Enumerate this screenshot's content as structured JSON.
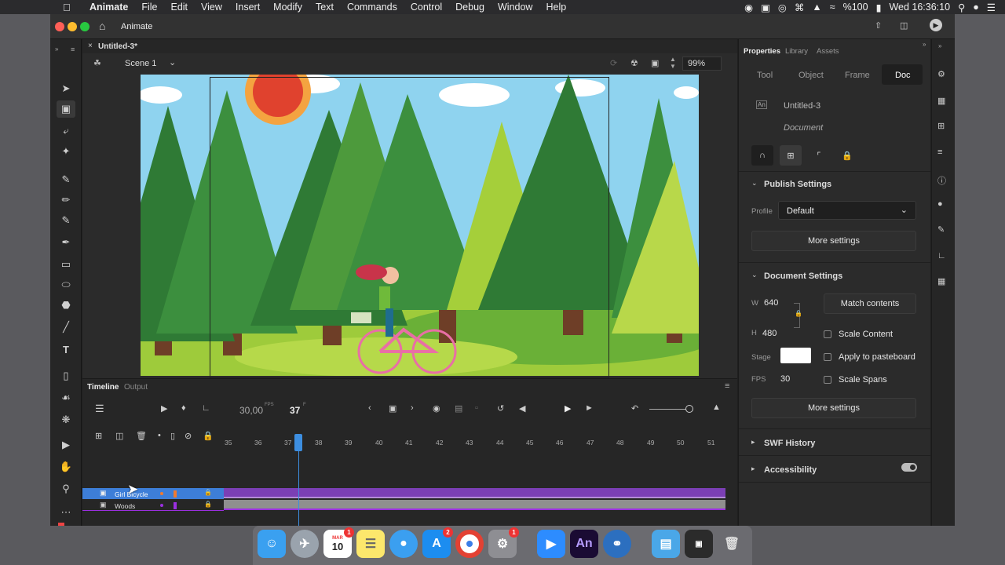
{
  "menubar": {
    "items": [
      "Animate",
      "File",
      "Edit",
      "View",
      "Insert",
      "Modify",
      "Text",
      "Commands",
      "Control",
      "Debug",
      "Window",
      "Help"
    ],
    "battery": "%100",
    "clock": "Wed 16:36:10"
  },
  "window": {
    "home_label": "Animate"
  },
  "document": {
    "tab_title": "Untitled-3*",
    "scene": "Scene 1",
    "zoom": "99%"
  },
  "timeline": {
    "tab_timeline": "Timeline",
    "tab_output": "Output",
    "fps": "30,00",
    "fps_unit": "FPS",
    "frame": "37",
    "frame_unit": "F",
    "ruler": [
      "35",
      "36",
      "37",
      "38",
      "39",
      "40",
      "41",
      "42",
      "43",
      "44",
      "45",
      "46",
      "47",
      "48",
      "49",
      "50",
      "51"
    ],
    "layers": [
      {
        "name": "Girl Bicycle",
        "color": "#f07a30"
      },
      {
        "name": "Woods",
        "color": "#9b2fe0"
      }
    ]
  },
  "properties": {
    "panel_tabs": [
      "Properties",
      "Library",
      "Assets"
    ],
    "sub_tabs": [
      "Tool",
      "Object",
      "Frame",
      "Doc"
    ],
    "doc_name": "Untitled-3",
    "doc_type": "Document",
    "publish_settings": "Publish Settings",
    "profile_label": "Profile",
    "profile_value": "Default",
    "more_settings": "More settings",
    "document_settings": "Document Settings",
    "w_label": "W",
    "w_value": "640",
    "h_label": "H",
    "h_value": "480",
    "match_contents": "Match contents",
    "scale_content": "Scale Content",
    "stage_label": "Stage",
    "apply_pasteboard": "Apply to pasteboard",
    "fps_label": "FPS",
    "fps_value": "30",
    "scale_spans": "Scale Spans",
    "more_settings2": "More settings",
    "swf_history": "SWF History",
    "accessibility": "Accessibility"
  },
  "dock": {
    "calendar_month": "MAR",
    "calendar_day": "10",
    "calendar_badge": "1",
    "appstore_badge": "2",
    "prefs_badge": "1",
    "animate_label": "An"
  },
  "colors": {
    "sky": "#8fd3ef",
    "accent_blue": "#3d8ee0",
    "layer_band": "#7b3fb5"
  }
}
